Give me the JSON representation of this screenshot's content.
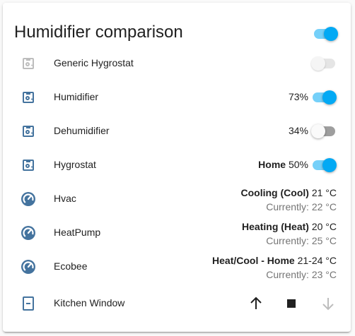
{
  "card": {
    "title": "Humidifier comparison",
    "header_toggle_on": true
  },
  "colors": {
    "accent": "#03a9f4",
    "icon": "#44739e",
    "icon_disabled": "#bdbdbd",
    "secondary_text": "#757575"
  },
  "rows": [
    {
      "name": "Generic Hygrostat",
      "icon": "humidifier-off-icon",
      "toggle": "disabled"
    },
    {
      "name": "Humidifier",
      "icon": "humidifier-icon",
      "value": "73%",
      "toggle": "on"
    },
    {
      "name": "Dehumidifier",
      "icon": "humidifier-icon",
      "value": "34%",
      "toggle": "off"
    },
    {
      "name": "Hygrostat",
      "icon": "humidifier-icon",
      "mode": "Home",
      "value": "50%",
      "toggle": "on"
    },
    {
      "name": "Hvac",
      "icon": "thermostat-icon",
      "state_bold": "Cooling (Cool)",
      "state_value": "21 °C",
      "current": "Currently: 22 °C"
    },
    {
      "name": "HeatPump",
      "icon": "thermostat-icon",
      "state_bold": "Heating (Heat)",
      "state_value": "20 °C",
      "current": "Currently: 25 °C"
    },
    {
      "name": "Ecobee",
      "icon": "thermostat-icon",
      "state_bold": "Heat/Cool - Home",
      "state_value": "21-24 °C",
      "current": "Currently: 23 °C"
    },
    {
      "name": "Kitchen Window",
      "icon": "window-closed-icon",
      "controls": [
        "open-cover",
        "stop-cover",
        "close-cover"
      ],
      "close_disabled": true
    }
  ]
}
